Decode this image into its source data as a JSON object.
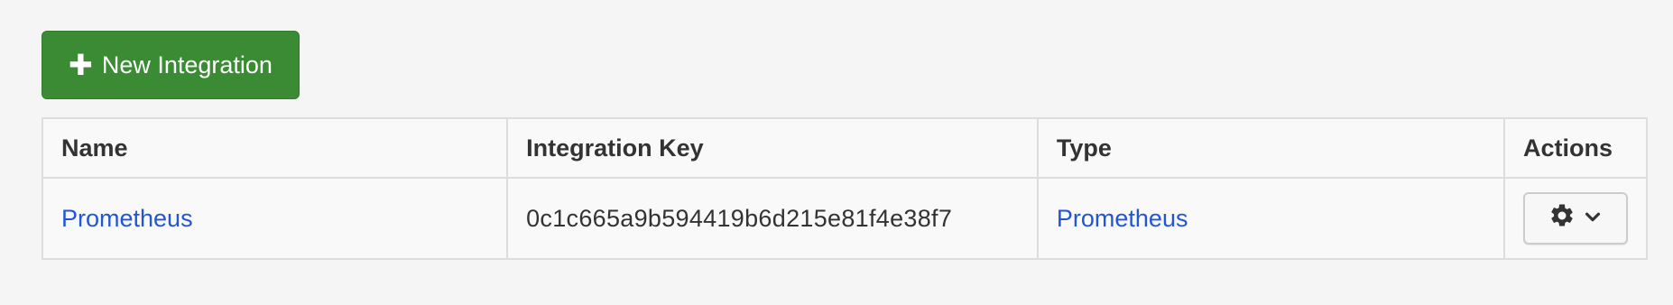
{
  "toolbar": {
    "new_integration_label": "New Integration",
    "icon": "plus-icon"
  },
  "table": {
    "headers": {
      "name": "Name",
      "key": "Integration Key",
      "type": "Type",
      "actions": "Actions"
    },
    "rows": [
      {
        "name": "Prometheus",
        "integration_key": "0c1c665a9b594419b6d215e81f4e38f7",
        "type": "Prometheus",
        "actions_icons": [
          "gear-icon",
          "chevron-down-icon"
        ]
      }
    ]
  },
  "colors": {
    "primary_button": "#3b8b35",
    "link": "#2356d4",
    "background": "#f5f5f5"
  }
}
